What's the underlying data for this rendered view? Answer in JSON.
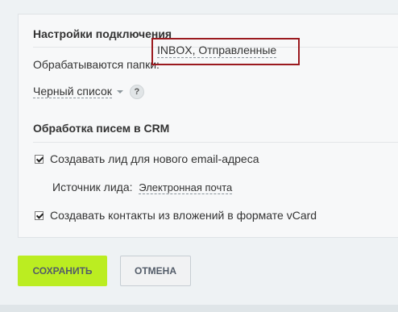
{
  "connection": {
    "title": "Настройки подключения",
    "folders_label": "Обрабатываются папки:",
    "folders_value": "INBOX, Отправленные",
    "blacklist_label": "Черный список",
    "help_symbol": "?"
  },
  "crm": {
    "title": "Обработка писем в CRM",
    "create_lead_label": "Создавать лид для нового email-адреса",
    "create_lead_checked": true,
    "lead_source_label": "Источник лида:",
    "lead_source_value": "Электронная почта",
    "create_contacts_label": "Создавать контакты из вложений в формате vCard",
    "create_contacts_checked": true
  },
  "buttons": {
    "save_label": "СОХРАНИТЬ",
    "cancel_label": "ОТМЕНА"
  },
  "colors": {
    "save_button": "#bbed21",
    "highlight_border": "#9b1a1f"
  }
}
